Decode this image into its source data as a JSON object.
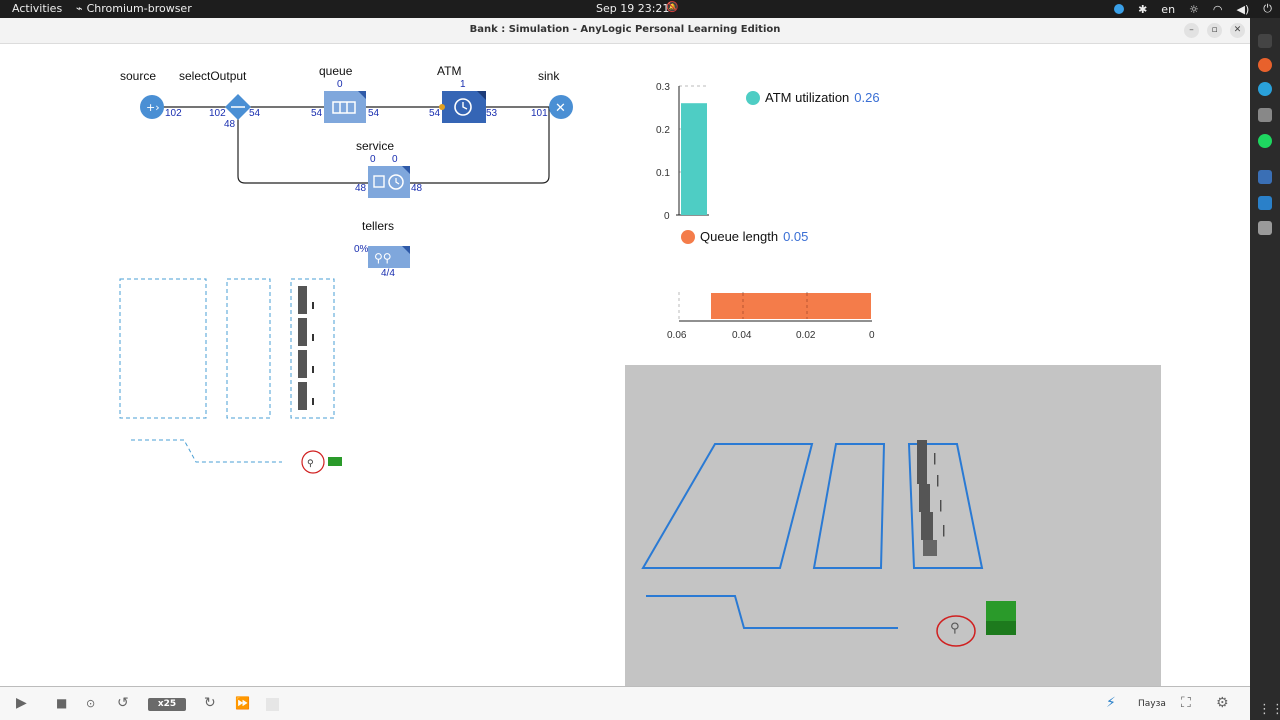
{
  "topbar": {
    "activities": "Activities",
    "app_name": "Chromium-browser",
    "clock": "Sep 19  23:21",
    "lang": "en"
  },
  "window": {
    "title": "Bank : Simulation - AnyLogic Personal Learning Edition"
  },
  "flowchart": {
    "source": {
      "label": "source",
      "out": "102"
    },
    "selectOutput": {
      "label": "selectOutput",
      "in": "102",
      "out_true": "54",
      "out_false": "48"
    },
    "queue": {
      "label": "queue",
      "count": "0",
      "in": "54",
      "out": "54"
    },
    "atm": {
      "label": "ATM",
      "count": "1",
      "in": "54",
      "out": "53"
    },
    "sink": {
      "label": "sink",
      "in": "101"
    },
    "service": {
      "label": "service",
      "count_left": "0",
      "count_right": "0",
      "in": "48",
      "out": "48"
    },
    "tellers": {
      "label": "tellers",
      "utilization": "0%",
      "capacity": "4/4"
    }
  },
  "charts": {
    "atm_legend": {
      "label": "ATM utilization",
      "value": "0.26",
      "color": "#4ecdc4"
    },
    "queue_legend": {
      "label": "Queue length",
      "value": "0.05",
      "color": "#f47c4a"
    }
  },
  "chart_data": [
    {
      "type": "bar",
      "categories": [
        "ATM utilization"
      ],
      "values": [
        0.26
      ],
      "ylim": [
        0,
        0.3
      ],
      "yticks": [
        "0",
        "0.1",
        "0.2",
        "0.3"
      ],
      "color": "#4ecdc4"
    },
    {
      "type": "bar",
      "orientation": "horizontal",
      "categories": [
        "Queue length"
      ],
      "values": [
        0.05
      ],
      "xlim": [
        0.06,
        0
      ],
      "xticks": [
        "0.06",
        "0.04",
        "0.02",
        "0"
      ],
      "color": "#f47c4a"
    }
  ],
  "controls": {
    "speed": "x25",
    "pause_label": "Пауза"
  }
}
